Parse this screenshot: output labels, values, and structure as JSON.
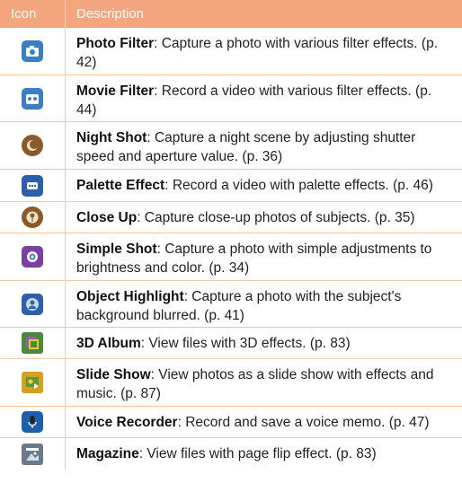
{
  "header": {
    "icon": "Icon",
    "description": "Description"
  },
  "rows": [
    {
      "icon": "photo-filter-icon",
      "title": "Photo Filter",
      "text": ": Capture a photo with various filter effects. (p. 42)",
      "color": "#3a7fc2"
    },
    {
      "icon": "movie-filter-icon",
      "title": "Movie Filter",
      "text": ": Record a video with various filter effects. (p. 44)",
      "color": "#3a7fc2"
    },
    {
      "icon": "night-shot-icon",
      "title": "Night Shot",
      "text": ": Capture a night scene by adjusting shutter speed and aperture value. (p. 36)",
      "color": "#8a5a2a"
    },
    {
      "icon": "palette-effect-icon",
      "title": "Palette Effect",
      "text": ": Record a video with palette effects. (p. 46)",
      "color": "#2e5fa8"
    },
    {
      "icon": "close-up-icon",
      "title": "Close Up",
      "text": ": Capture close-up photos of subjects. (p. 35)",
      "color": "#8a5a2a"
    },
    {
      "icon": "simple-shot-icon",
      "title": "Simple Shot",
      "text": ": Capture a photo with simple adjustments to brightness and color. (p. 34)",
      "color": "#7a3fa0"
    },
    {
      "icon": "object-highlight-icon",
      "title": "Object Highlight",
      "text": ": Capture a photo with the subject's background blurred. (p. 41)",
      "color": "#2e5fa8"
    },
    {
      "icon": "3d-album-icon",
      "title": "3D Album",
      "text": ": View files with 3D effects. (p. 83)",
      "color": "#4a8a3a"
    },
    {
      "icon": "slide-show-icon",
      "title": "Slide Show",
      "text": ": View photos as a slide show with effects and music. (p. 87)",
      "color": "#d4a020"
    },
    {
      "icon": "voice-recorder-icon",
      "title": "Voice Recorder",
      "text": ": Record and save a voice memo. (p. 47)",
      "color": "#1f5fa8"
    },
    {
      "icon": "magazine-icon",
      "title": "Magazine",
      "text": ": View files with page flip effect. (p. 83)",
      "color": "#6a7a8a"
    }
  ]
}
